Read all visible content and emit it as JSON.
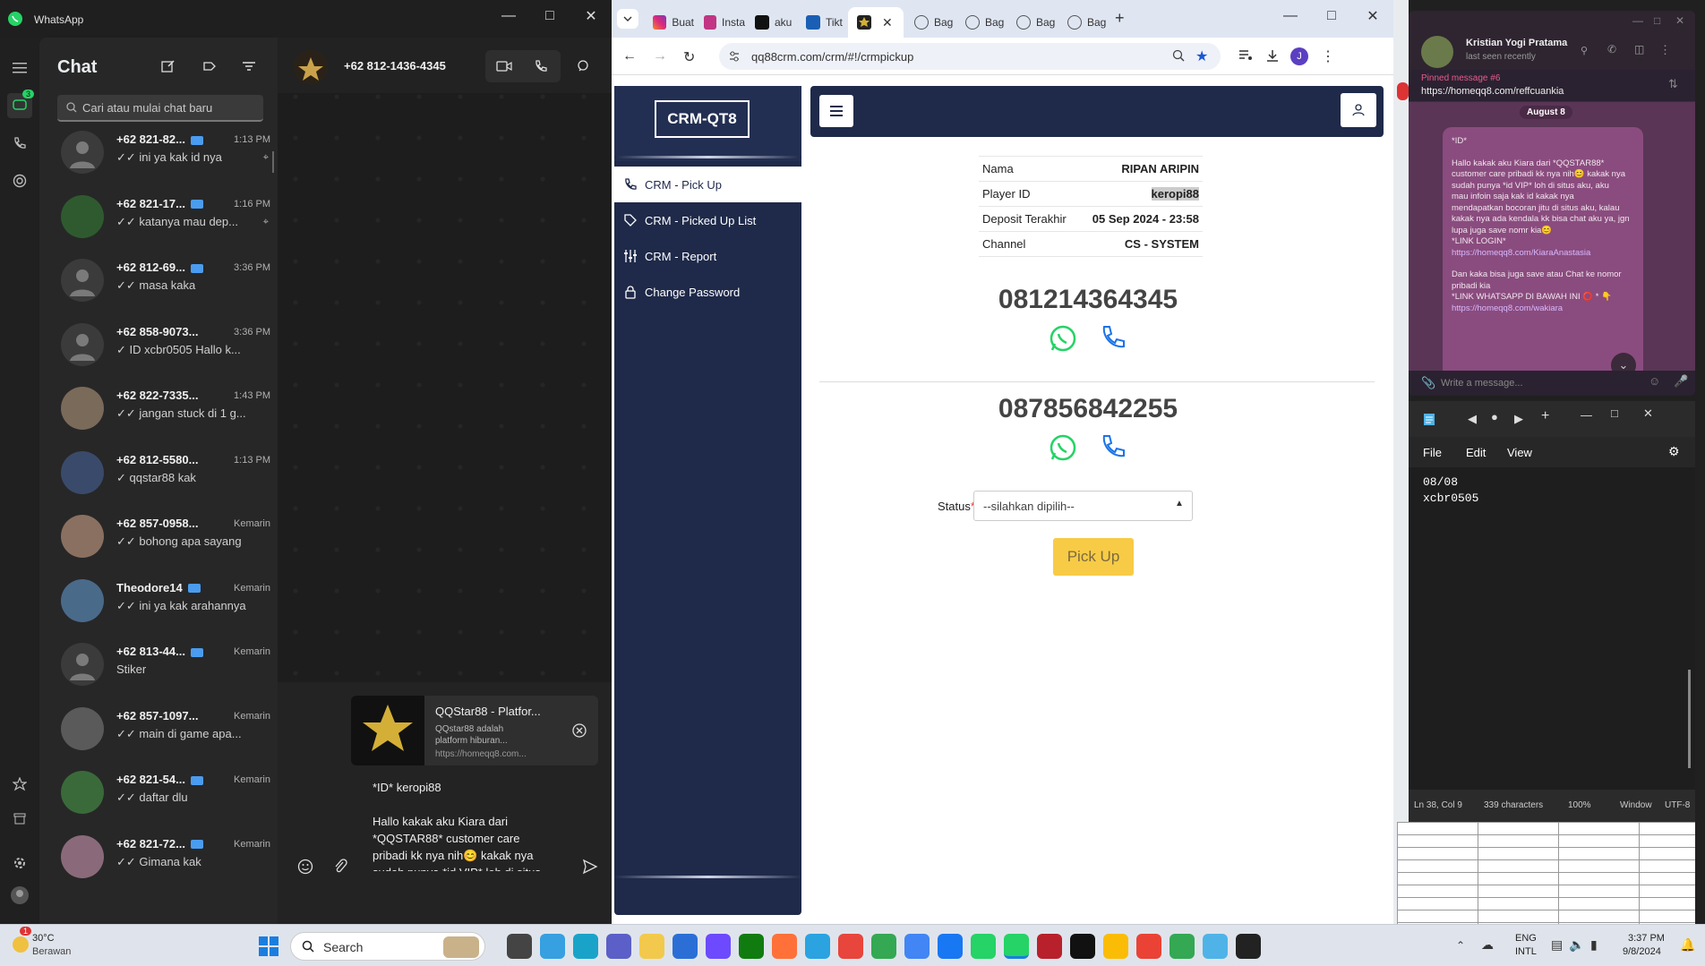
{
  "whatsapp": {
    "app_title": "WhatsApp",
    "list_title": "Chat",
    "search_placeholder": "Cari atau mulai chat baru",
    "chat_badge": "3",
    "chats": [
      {
        "name": "+62 821-82...",
        "time": "1:13 PM",
        "preview": "✓✓ ini ya kak id nya",
        "verified": true
      },
      {
        "name": "+62 821-17...",
        "time": "1:16 PM",
        "preview": "✓✓ katanya mau dep...",
        "verified": true
      },
      {
        "name": "+62 812-69...",
        "time": "3:36 PM",
        "preview": "✓✓ masa kaka",
        "verified": true
      },
      {
        "name": "+62 858-9073...",
        "time": "3:36 PM",
        "preview": "✓ ID xcbr0505  Hallo k...",
        "verified": false
      },
      {
        "name": "+62 822-7335...",
        "time": "1:43 PM",
        "preview": "✓✓ jangan stuck di 1 g...",
        "verified": false
      },
      {
        "name": "+62 812-5580...",
        "time": "1:13 PM",
        "preview": "✓ qqstar88 kak",
        "verified": false
      },
      {
        "name": "+62 857-0958...",
        "time": "Kemarin",
        "preview": "✓✓ bohong apa sayang",
        "verified": false
      },
      {
        "name": "Theodore14",
        "time": "Kemarin",
        "preview": "✓✓ ini ya kak arahannya",
        "verified": true
      },
      {
        "name": "+62 813-44...",
        "time": "Kemarin",
        "preview": "Stiker",
        "verified": true
      },
      {
        "name": "+62 857-1097...",
        "time": "Kemarin",
        "preview": "✓✓ main di game apa...",
        "verified": false
      },
      {
        "name": "+62 821-54...",
        "time": "Kemarin",
        "preview": "✓✓ daftar dlu",
        "verified": true
      },
      {
        "name": "+62 821-72...",
        "time": "Kemarin",
        "preview": "✓✓ Gimana kak",
        "verified": true
      }
    ],
    "convo_title": "+62 812-1436-4345",
    "link_preview": {
      "title": "QQStar88 - Platfor...",
      "desc1": "QQstar88 adalah",
      "desc2": "platform hiburan...",
      "url": "https://homeqq8.com..."
    },
    "draft_line1": "*ID* keropi88",
    "draft_line2": "Hallo kakak aku Kiara dari",
    "draft_line3": "*QQSTAR88* customer care",
    "draft_line4": "pribadi kk nya nih😊 kakak nya",
    "draft_line5": "sudah punya *id VIP* loh di situs"
  },
  "browser": {
    "tabs": [
      "Buat",
      "Insta",
      "aku",
      "Tikt",
      "",
      "Bag",
      "Bag",
      "Bag",
      "Bag"
    ],
    "url": "qq88crm.com/crm/#!/crmpickup",
    "profile_initial": "J"
  },
  "crm": {
    "logo": "CRM-QT8",
    "menu": [
      "CRM - Pick Up",
      "CRM - Picked Up List",
      "CRM - Report",
      "Change Password"
    ],
    "info": [
      {
        "label": "Nama",
        "value": "RIPAN ARIPIN"
      },
      {
        "label": "Player ID",
        "value": "keropi88"
      },
      {
        "label": "Deposit Terakhir",
        "value": "05 Sep 2024 - 23:58"
      },
      {
        "label": "Channel",
        "value": "CS - SYSTEM"
      }
    ],
    "phone1": "081214364345",
    "phone2": "087856842255",
    "status_label": "Status",
    "status_required": "*",
    "status_placeholder": "--silahkan dipilih--",
    "pickup_button": "Pick Up"
  },
  "telegram": {
    "name": "Kristian Yogi Pratama",
    "status": "last seen recently",
    "pinned_label": "Pinned message #6",
    "pinned_url": "https://homeqq8.com/reffcuankia",
    "date": "August 8",
    "msg_lines": [
      "*ID*",
      "",
      "Hallo kakak aku Kiara dari *QQSTAR88*",
      "customer care pribadi kk nya nih😊 kakak nya",
      "sudah punya *id VIP* loh di situs aku, aku",
      "mau infoin saja kak id kakak nya",
      "mendapatkan bocoran jitu di situs aku, kalau",
      "kakak nya ada kendala kk bisa chat aku ya, jgn",
      "lupa juga save nomr kia😊",
      "*LINK LOGIN*"
    ],
    "msg_link1": "https://homeqq8.com/KiaraAnastasia",
    "msg_lines2": [
      "Dan kaka bisa juga save atau Chat ke nomor",
      "pribadi kia",
      "*LINK WHATSAPP DI BAWAH INI ⭕ * 👇"
    ],
    "msg_link2": "https://homeqq8.com/wakiara",
    "input_placeholder": "Write a message..."
  },
  "notepad": {
    "menu": [
      "File",
      "Edit",
      "View"
    ],
    "lines": [
      "08/08",
      "xcbr0505"
    ],
    "status": [
      "Ln 38, Col 9",
      "339 characters",
      "100%",
      "Window",
      "UTF-8"
    ]
  },
  "taskbar": {
    "temp": "30°C",
    "weather": "Berawan",
    "weather_badge": "1",
    "search": "Search",
    "lang1": "ENG",
    "lang2": "INTL",
    "time": "3:37 PM",
    "date": "9/8/2024"
  }
}
